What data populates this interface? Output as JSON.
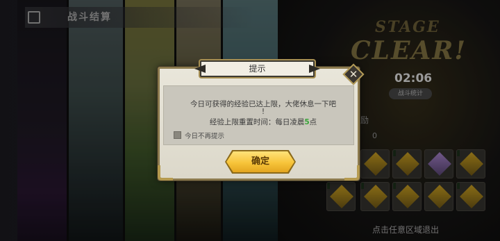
{
  "background": {
    "result_title": "战斗结算",
    "stage_word": "STAGE",
    "clear_word": "CLEAR!",
    "timer": "02:06",
    "stats_button": "战斗统计",
    "reward_label": "励",
    "reward_count": "0",
    "exit_hint": "点击任意区域退出"
  },
  "dialog": {
    "title": "提示",
    "message_line1": "今日可获得的经验已达上限，大佬休息一下吧",
    "message_line2": "!",
    "message_line3_prefix": "经验上限重置时间：每日凌晨",
    "message_line3_highlight": "5",
    "message_line3_suffix": "点",
    "checkbox_label": "今日不再提示",
    "confirm_label": "确定",
    "close_icon": "close-icon"
  },
  "colors": {
    "accent_gold": "#f7c43a",
    "highlight_green": "#3aa43a",
    "dialog_bg": "#e9e6da",
    "frame_gold": "#8c7a4e"
  }
}
